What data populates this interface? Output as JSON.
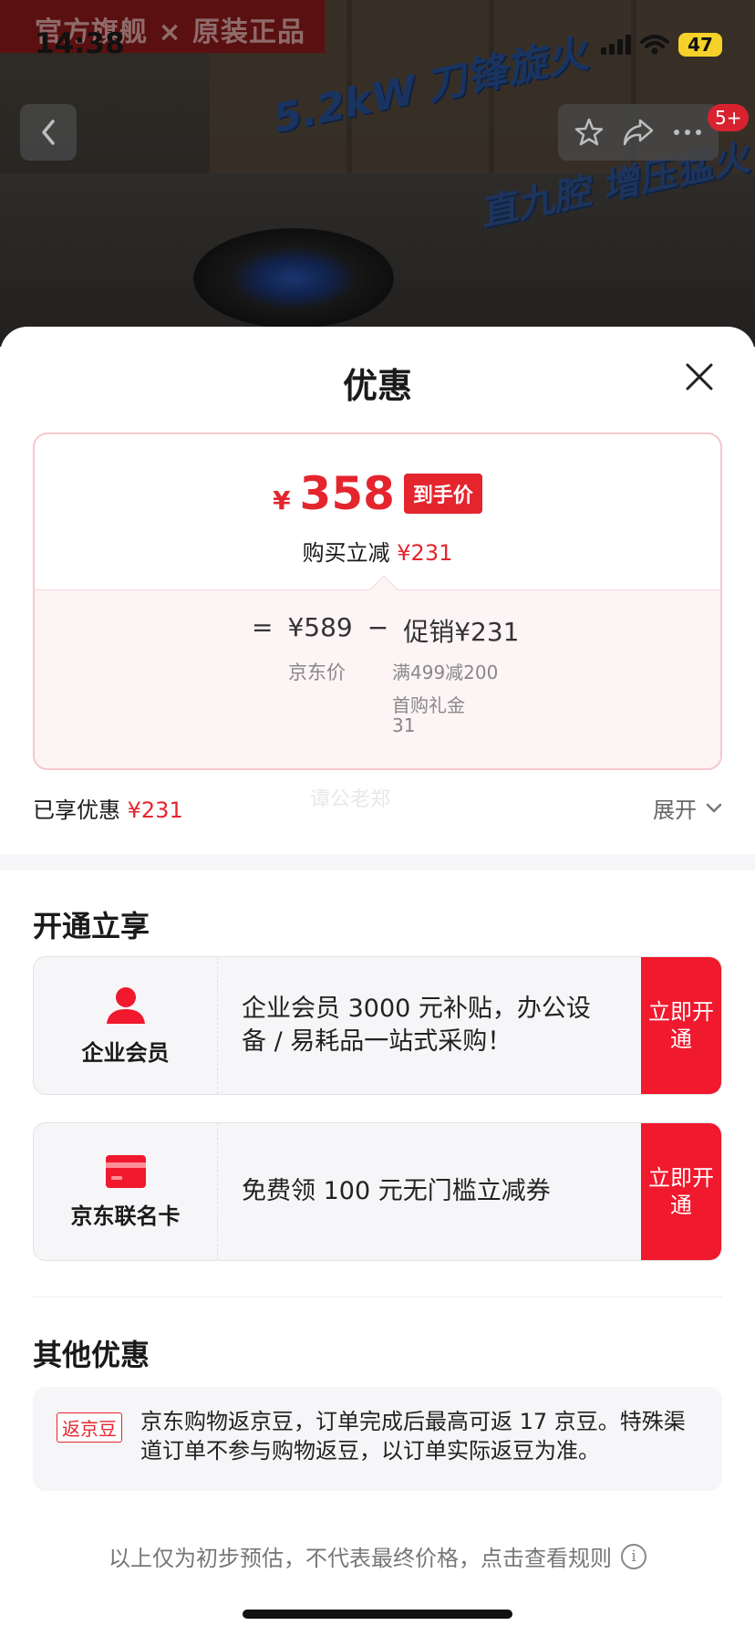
{
  "status": {
    "time": "14:38",
    "battery": "47"
  },
  "store_banner": "官方旗舰 × 原装正品",
  "product_bg": {
    "text1": "5.2kW 刀锋旋火",
    "text2": "直九腔 增压猛火"
  },
  "nav": {
    "badge": "5+"
  },
  "sheet": {
    "title": "优惠",
    "price_card": {
      "currency": "¥",
      "final_price": "358",
      "final_tag": "到手价",
      "reduce_label": "购买立减",
      "reduce_amount": "¥231",
      "equals": "=",
      "jd_price": "¥589",
      "minus": "−",
      "promo_label": "促销¥231",
      "jd_price_label": "京东价",
      "promo_items": [
        "满499减200",
        "首购礼金",
        "31"
      ]
    },
    "enjoyed_label": "已享优惠",
    "enjoyed_amount": "¥231",
    "expand_label": "展开",
    "watermark": "谭公老郑",
    "open_section_title": "开通立享",
    "offers": [
      {
        "name": "企业会员",
        "desc": "企业会员 3000 元补贴，办公设备 / 易耗品一站式采购！",
        "button": "立即开通",
        "icon": "person-icon"
      },
      {
        "name": "京东联名卡",
        "desc": "免费领 100 元无门槛立减券",
        "button": "立即开通",
        "icon": "card-icon"
      }
    ],
    "other_section_title": "其他优惠",
    "jingdou": {
      "tag": "返京豆",
      "text": "京东购物返京豆，订单完成后最高可返 17 京豆。特殊渠道订单不参与购物返豆，以订单实际返豆为准。"
    },
    "footer_note": "以上仅为初步预估，不代表最终价格，点击查看规则"
  },
  "colors": {
    "accent": "#e4252d",
    "button": "#f0192d",
    "card_border": "#f6c7cd"
  }
}
